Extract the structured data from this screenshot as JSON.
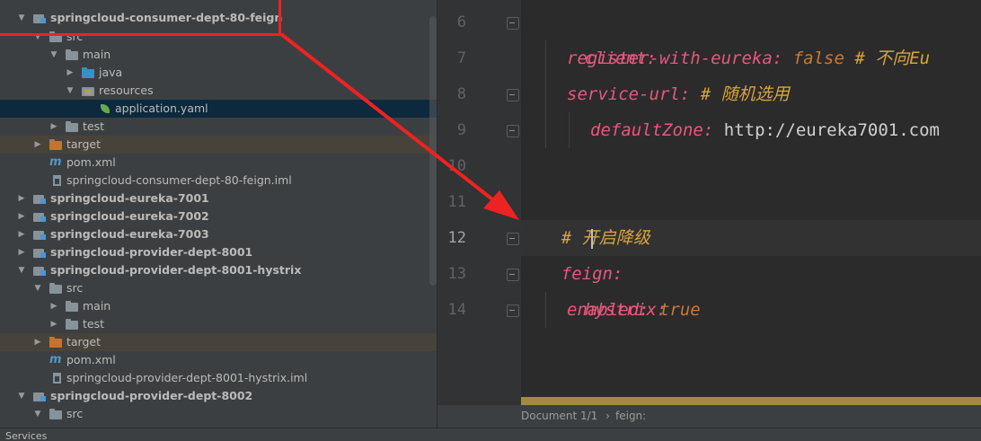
{
  "tree": {
    "items": [
      {
        "label": "springcloud-consumer-dept-80-feign",
        "arrow": "▼"
      },
      {
        "label": "src",
        "arrow": "▼"
      },
      {
        "label": "main",
        "arrow": "▼"
      },
      {
        "label": "java",
        "arrow": "▶"
      },
      {
        "label": "resources",
        "arrow": "▼"
      },
      {
        "label": "application.yaml",
        "arrow": ""
      },
      {
        "label": "test",
        "arrow": "▶"
      },
      {
        "label": "target",
        "arrow": "▶"
      },
      {
        "label": "pom.xml",
        "arrow": ""
      },
      {
        "label": "springcloud-consumer-dept-80-feign.iml",
        "arrow": ""
      },
      {
        "label": "springcloud-eureka-7001",
        "arrow": "▶"
      },
      {
        "label": "springcloud-eureka-7002",
        "arrow": "▶"
      },
      {
        "label": "springcloud-eureka-7003",
        "arrow": "▶"
      },
      {
        "label": "springcloud-provider-dept-8001",
        "arrow": "▶"
      },
      {
        "label": "springcloud-provider-dept-8001-hystrix",
        "arrow": "▼"
      },
      {
        "label": "src",
        "arrow": "▼"
      },
      {
        "label": "main",
        "arrow": "▶"
      },
      {
        "label": "test",
        "arrow": "▶"
      },
      {
        "label": "target",
        "arrow": "▶"
      },
      {
        "label": "pom.xml",
        "arrow": ""
      },
      {
        "label": "springcloud-provider-dept-8001-hystrix.iml",
        "arrow": ""
      },
      {
        "label": "springcloud-provider-dept-8002",
        "arrow": "▼"
      },
      {
        "label": "src",
        "arrow": "▼"
      }
    ],
    "pom_icon": "m"
  },
  "editor": {
    "line_numbers": [
      "6",
      "7",
      "8",
      "9",
      "10",
      "11",
      "12",
      "13",
      "14"
    ],
    "lines": {
      "l6_key": "client:",
      "l7_key": "register-with-eureka",
      "l7_colon": ":",
      "l7_val": "false",
      "l7_comment": "# 不向Eu",
      "l8_key": "service-url",
      "l8_colon": ":",
      "l8_comment": "# 随机选用",
      "l9_key": "defaultZone",
      "l9_colon": ":",
      "l9_val": "http://eureka7001.com",
      "l11_comment": "# 开启降级",
      "l12_key": "feign:",
      "l13_key": "hystrix:",
      "l14_key": "enabled",
      "l14_colon": ":",
      "l14_val": "true"
    }
  },
  "breadcrumb": {
    "doc": "Document 1/1",
    "sep": "›",
    "path": "feign:"
  },
  "bottom": {
    "tool_window": "Services"
  },
  "colors": {
    "annotation": "#ee2222",
    "selection": "#0d293e",
    "key": "#e8577d",
    "comment": "#d8a43c"
  }
}
